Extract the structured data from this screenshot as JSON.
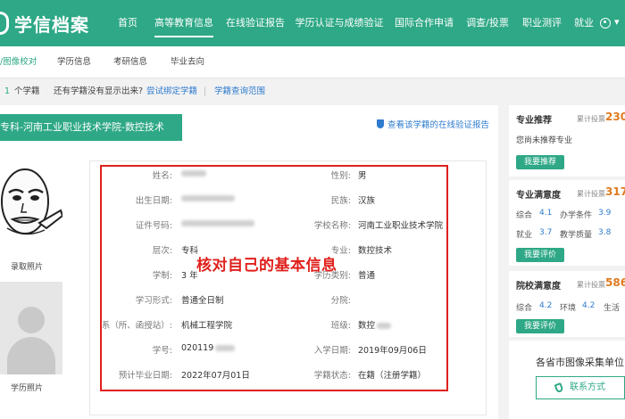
{
  "brand": {
    "logo_text": "学信档案"
  },
  "nav": {
    "items": [
      {
        "label": "首页",
        "active": false
      },
      {
        "label": "高等教育信息",
        "active": true
      },
      {
        "label": "在线验证报告",
        "active": false
      },
      {
        "label": "学历认证与成绩验证",
        "active": false
      },
      {
        "label": "国际合作申请",
        "active": false
      },
      {
        "label": "调查/投票",
        "active": false
      },
      {
        "label": "职业测评",
        "active": false
      },
      {
        "label": "就业",
        "active": false
      }
    ]
  },
  "subnav": {
    "items": [
      {
        "label": "/图像校对",
        "active": true
      },
      {
        "label": "学历信息",
        "active": false
      },
      {
        "label": "考研信息",
        "active": false
      },
      {
        "label": "毕业去向",
        "active": false
      }
    ]
  },
  "notice": {
    "count": "1",
    "count_suffix": "个学籍",
    "question": "还有学籍没有显示出来?",
    "link_bind": "尝试绑定学籍",
    "separator": "|",
    "link_scope": "学籍查询范围"
  },
  "record": {
    "school_banner": "专科-河南工业职业技术学院-数控技术",
    "verify_link": "查看该学籍的在线验证报告",
    "photo_admission_label": "录取照片",
    "photo_degree_label": "学历照片",
    "fields_left": [
      {
        "label": "姓名:",
        "value": ""
      },
      {
        "label": "出生日期:",
        "value": ""
      },
      {
        "label": "证件号码:",
        "value": ""
      },
      {
        "label": "层次:",
        "value": "专科"
      },
      {
        "label": "学制:",
        "value": "3 年"
      },
      {
        "label": "学习形式:",
        "value": "普通全日制"
      },
      {
        "label": "系（所、函授站）:",
        "value": "机械工程学院"
      },
      {
        "label": "学号:",
        "value": "020119"
      },
      {
        "label": "预计毕业日期:",
        "value": "2022年07月01日"
      }
    ],
    "fields_right": [
      {
        "label": "性别:",
        "value": "男"
      },
      {
        "label": "民族:",
        "value": "汉族"
      },
      {
        "label": "学校名称:",
        "value": "河南工业职业技术学院"
      },
      {
        "label": "专业:",
        "value": "数控技术"
      },
      {
        "label": "学历类别:",
        "value": "普通"
      },
      {
        "label": "分院:",
        "value": ""
      },
      {
        "label": "班级:",
        "value": "数控"
      },
      {
        "label": "入学日期:",
        "value": "2019年09月06日"
      },
      {
        "label": "学籍状态:",
        "value": "在籍（注册学籍）"
      }
    ],
    "annotation": "核对自己的基本信息"
  },
  "right_cards": {
    "recommend": {
      "title": "专业推荐",
      "count_label": "累计投票",
      "count": "230",
      "text": "您尚未推荐专业",
      "button": "我要推荐"
    },
    "major_satisfaction": {
      "title": "专业满意度",
      "count_label": "累计投票",
      "count": "317",
      "scores": [
        {
          "label": "综合",
          "value": "4.1"
        },
        {
          "label": "办学条件",
          "value": "3.9"
        },
        {
          "label": "就业",
          "value": "3.7"
        },
        {
          "label": "教学质量",
          "value": "3.8"
        }
      ],
      "button": "我要评价"
    },
    "school_satisfaction": {
      "title": "院校满意度",
      "count_label": "累计投票",
      "count": "586",
      "scores": [
        {
          "label": "综合",
          "value": "4.2"
        },
        {
          "label": "环境",
          "value": "4.2"
        },
        {
          "label": "生活",
          "value": ""
        }
      ],
      "button": "我要评价"
    }
  },
  "collect": {
    "title": "各省市图像采集单位",
    "button": "联系方式"
  },
  "colors": {
    "brand_green": "#2ea886",
    "link_blue": "#2e7bcf",
    "annotation_red": "#e0201c",
    "count_orange": "#e07a1f"
  },
  "icons": [
    "user-icon",
    "shield-icon",
    "phone-icon",
    "avatar-placeholder-icon"
  ]
}
